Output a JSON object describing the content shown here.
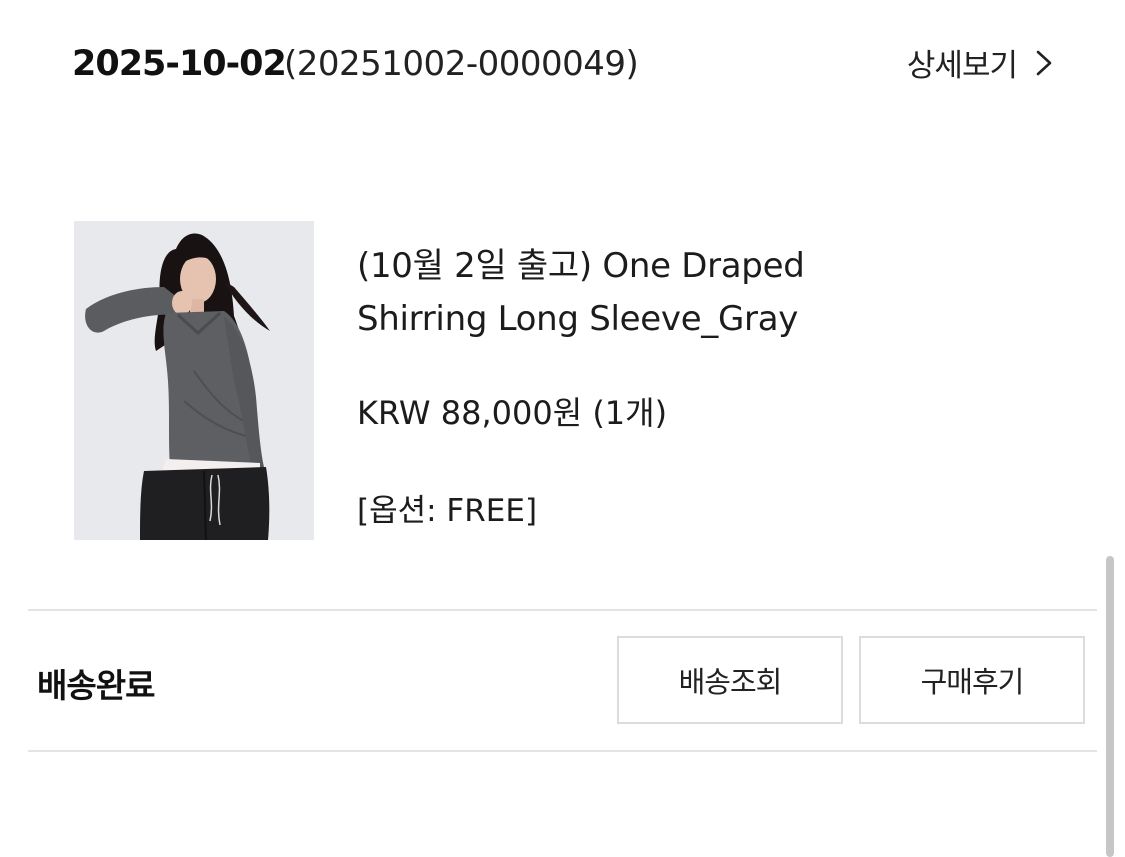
{
  "order": {
    "date": "2025-10-02",
    "number": "(20251002-0000049)",
    "detail_label": "상세보기"
  },
  "product": {
    "name_line1": "(10월 2일 출고) One Draped",
    "name_line2": "Shirring Long Sleeve_Gray",
    "price": "KRW 88,000원 (1개)",
    "option": "[옵션: FREE]"
  },
  "status": {
    "label": "배송완료",
    "track_button": "배송조회",
    "review_button": "구매후기"
  },
  "icons": {
    "detail": "chevron-right-icon"
  },
  "colors": {
    "text": "#1c1c1c",
    "border": "#dcdcdc",
    "divider": "#e4e4e4"
  }
}
